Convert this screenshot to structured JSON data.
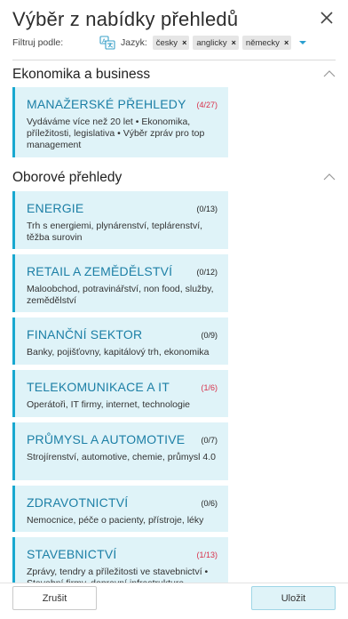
{
  "title": "Výběr z nabídky přehledů",
  "filter": {
    "label": "Filtruj podle:",
    "language_label": "Jazyk:",
    "chips": [
      "česky",
      "anglicky",
      "německy"
    ],
    "chip_remove": "×"
  },
  "sections": [
    {
      "title": "Ekonomika a business",
      "cards": [
        {
          "title": "MANAŽERSKÉ PŘEHLEDY",
          "count": "(4/27)",
          "highlight": true,
          "desc": "Vydáváme více než 20 let • Ekonomika, příležitosti, legislativa • Výběr zpráv pro top management"
        }
      ]
    },
    {
      "title": "Oborové přehledy",
      "cards": [
        {
          "title": "ENERGIE",
          "count": "(0/13)",
          "highlight": false,
          "desc": "Trh s energiemi, plynárenství, teplárenství, těžba surovin"
        },
        {
          "title": "RETAIL A ZEMĚDĚLSTVÍ",
          "count": "(0/12)",
          "highlight": false,
          "desc": "Maloobchod, potravinářství, non food, služby, zemědělství"
        },
        {
          "title": "FINANČNÍ SEKTOR",
          "count": "(0/9)",
          "highlight": false,
          "desc": "Banky, pojišťovny, kapitálový trh, ekonomika"
        },
        {
          "title": "TELEKOMUNIKACE A IT",
          "count": "(1/6)",
          "highlight": true,
          "desc": "Operátoři, IT firmy, internet, technologie"
        },
        {
          "title": "PRŮMYSL A AUTOMOTIVE",
          "count": "(0/7)",
          "highlight": false,
          "desc": "Strojírenství, automotive, chemie, průmysl 4.0"
        },
        {
          "title": "ZDRAVOTNICTVÍ",
          "count": "(0/6)",
          "highlight": false,
          "desc": "Nemocnice, péče o pacienty, přístroje, léky"
        },
        {
          "title": "STAVEBNICTVÍ",
          "count": "(1/13)",
          "highlight": true,
          "desc": "Zprávy, tendry a příležitosti ve stavebnictví • Stavební firmy, dopravní infrastruktura"
        }
      ]
    }
  ],
  "footer": {
    "cancel": "Zrušit",
    "ok": "Uložit"
  },
  "colors": {
    "accent": "#18a8d0",
    "card_bg": "#dff3f8",
    "title_blue": "#1c7fa6",
    "count_red": "#d8304a"
  },
  "icons": {
    "close": "close-icon",
    "language": "translate-icon",
    "dropdown": "dropdown-arrow-icon",
    "collapse": "chevron-up-icon"
  }
}
